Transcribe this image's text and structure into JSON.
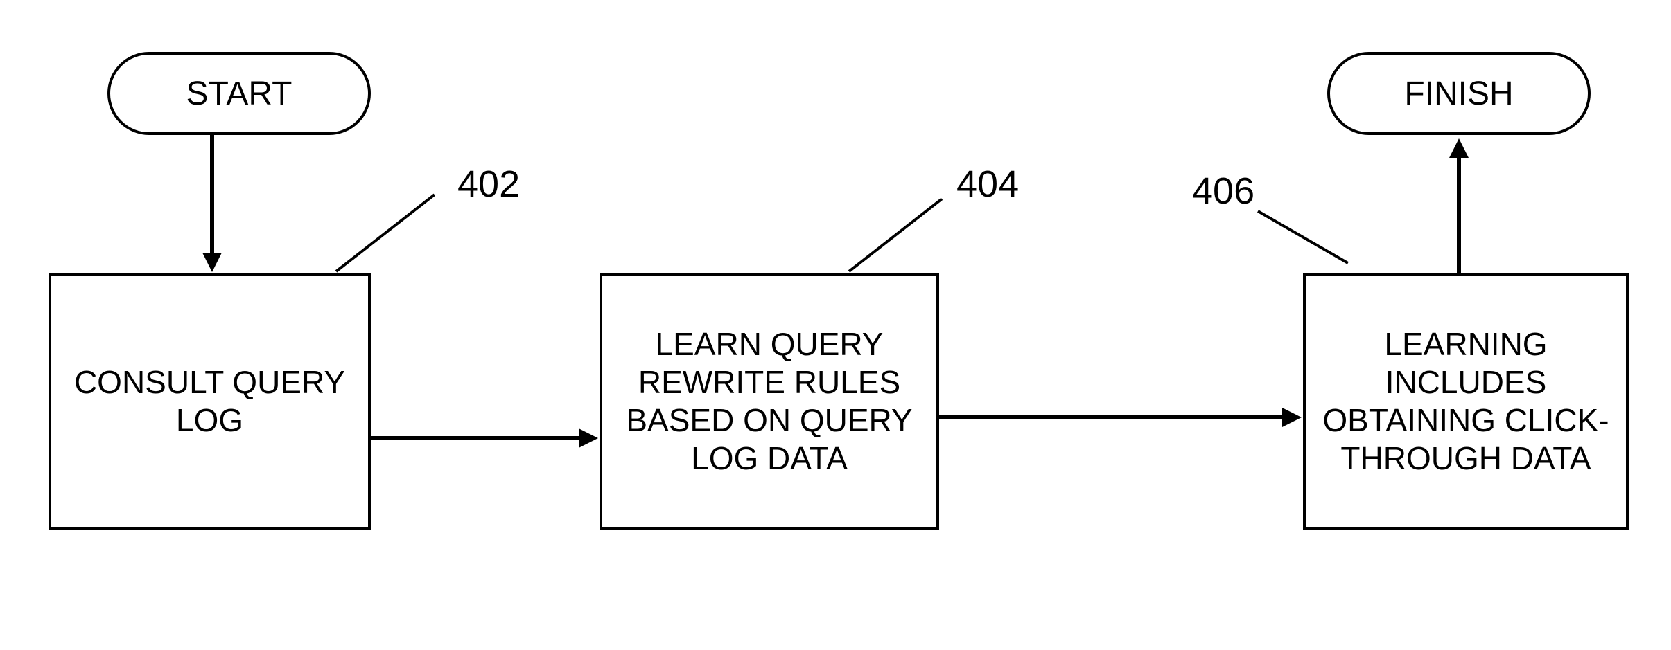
{
  "diagram": {
    "start": "START",
    "finish": "FINISH",
    "box1": "CONSULT QUERY LOG",
    "box2": "LEARN QUERY REWRITE RULES BASED ON QUERY LOG DATA",
    "box3": "LEARNING INCLUDES OBTAINING CLICK-THROUGH DATA",
    "label1": "402",
    "label2": "404",
    "label3": "406"
  }
}
